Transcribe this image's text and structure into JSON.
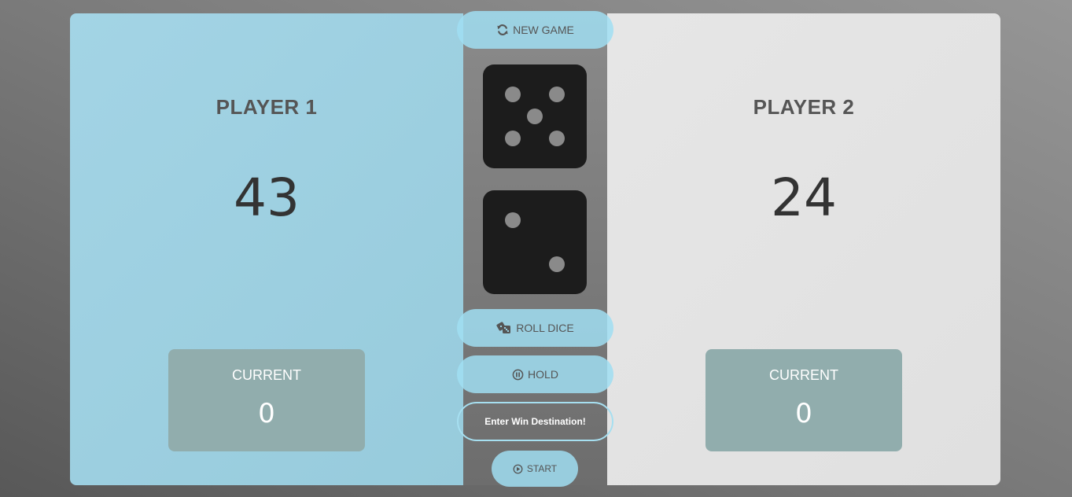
{
  "players": [
    {
      "name": "PLAYER 1",
      "score": "43",
      "current_label": "CURRENT",
      "current": "0",
      "active": true
    },
    {
      "name": "PLAYER 2",
      "score": "24",
      "current_label": "CURRENT",
      "current": "0",
      "active": false
    }
  ],
  "controls": {
    "new_game_label": "NEW GAME",
    "new_game_icon": "refresh-icon",
    "roll_dice_label": "ROLL DICE",
    "roll_dice_icon": "dice-icon",
    "hold_label": "HOLD",
    "hold_icon": "pause-circle-icon",
    "win_input_placeholder": "Enter Win Destination!",
    "win_input_value": "",
    "start_label": "START",
    "start_icon": "play-circle-icon"
  },
  "dice": [
    {
      "value": 5
    },
    {
      "value": 2
    }
  ],
  "colors": {
    "active_panel": "#a3d4e5",
    "inactive_panel": "#e6e6e6",
    "current_box": "#91adad",
    "button": "#a0def2",
    "dice_face": "#1c1c1c",
    "dice_pip": "#8a8a8a"
  }
}
